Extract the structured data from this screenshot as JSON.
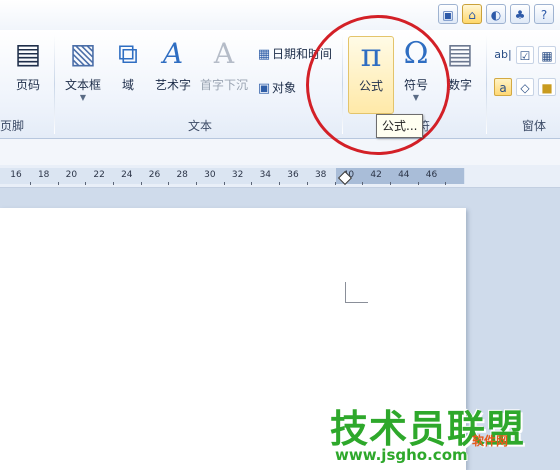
{
  "toolbar": {
    "buttons": {
      "page_number": {
        "label": "页码"
      },
      "text_box": {
        "label": "文本框"
      },
      "field": {
        "label": "域"
      },
      "word_art": {
        "label": "艺术字"
      },
      "drop_cap": {
        "label": "首字下沉"
      },
      "equation": {
        "label": "公式",
        "glyph": "π"
      },
      "symbol": {
        "label": "符号",
        "glyph": "Ω"
      },
      "number": {
        "label": "数字"
      }
    },
    "small_buttons": {
      "date_time": "日期和时间",
      "object": "对象"
    },
    "groups": {
      "header_footer": "页脚",
      "text": "文本",
      "symbols": "符",
      "window": "窗体"
    }
  },
  "tooltip": {
    "text": "公式..."
  },
  "ruler": {
    "labels": [
      "16",
      "18",
      "20",
      "22",
      "24",
      "26",
      "28",
      "30",
      "32",
      "34",
      "36",
      "38",
      "40",
      "42",
      "44",
      "46"
    ]
  },
  "watermark": {
    "text": "技术员联盟",
    "url": "www.jsgho.com",
    "corner": "软件网"
  },
  "colors": {
    "highlight": "#d32027",
    "watermark": "#2ea82b",
    "tooltip_bg": "#fffff1"
  }
}
